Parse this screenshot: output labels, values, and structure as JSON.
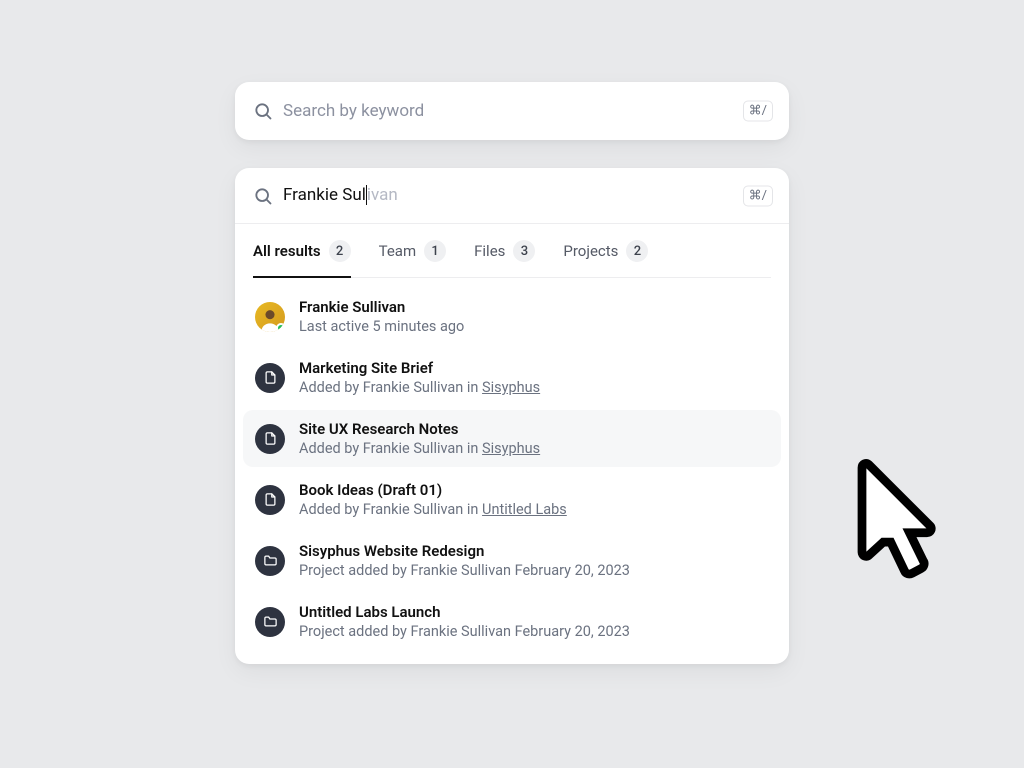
{
  "simple_search": {
    "placeholder": "Search by keyword",
    "shortcut": "⌘/"
  },
  "search": {
    "typed": "Frankie Sul",
    "ghost": "ivan",
    "shortcut": "⌘/"
  },
  "tabs": [
    {
      "label": "All results",
      "count": "2",
      "active": true
    },
    {
      "label": "Team",
      "count": "1",
      "active": false
    },
    {
      "label": "Files",
      "count": "3",
      "active": false
    },
    {
      "label": "Projects",
      "count": "2",
      "active": false
    }
  ],
  "results": [
    {
      "kind": "person",
      "title": "Frankie Sullivan",
      "subtitle_prefix": "Last active 5 minutes ago",
      "link_text": "",
      "hovered": false
    },
    {
      "kind": "file",
      "title": "Marketing Site Brief",
      "subtitle_prefix": "Added by Frankie Sullivan in ",
      "link_text": "Sisyphus",
      "hovered": false
    },
    {
      "kind": "file",
      "title": "Site UX Research Notes",
      "subtitle_prefix": "Added by Frankie Sullivan in ",
      "link_text": "Sisyphus",
      "hovered": true
    },
    {
      "kind": "file",
      "title": "Book Ideas (Draft 01)",
      "subtitle_prefix": "Added by Frankie Sullivan in ",
      "link_text": "Untitled Labs",
      "hovered": false
    },
    {
      "kind": "project",
      "title": "Sisyphus Website Redesign",
      "subtitle_prefix": "Project added by Frankie Sullivan February 20, 2023",
      "link_text": "",
      "hovered": false
    },
    {
      "kind": "project",
      "title": "Untitled Labs Launch",
      "subtitle_prefix": "Project added by Frankie Sullivan February 20, 2023",
      "link_text": "",
      "hovered": false
    }
  ]
}
